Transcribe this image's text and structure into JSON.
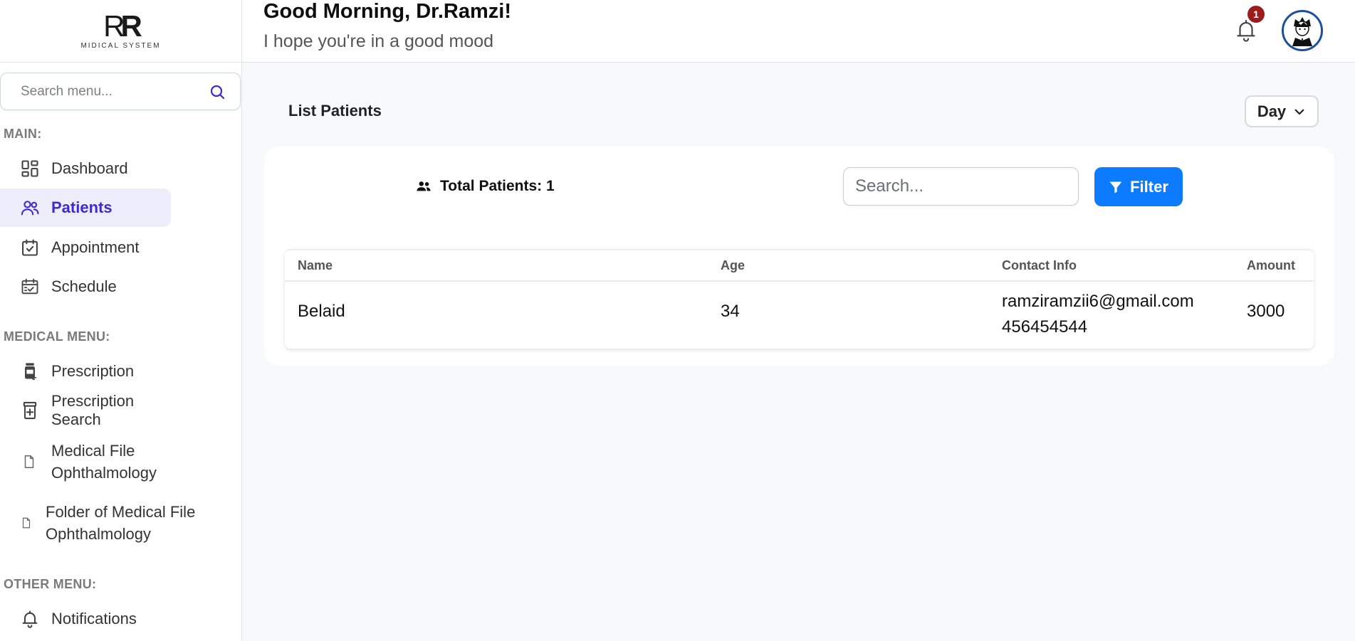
{
  "brand": {
    "logo_text_1": "R",
    "logo_text_2": "R",
    "logo_sub": "MIDICAL SYSTEM"
  },
  "sidebar": {
    "search_placeholder": "Search menu...",
    "sections": {
      "main": "MAIN:",
      "medical": "MEDICAL MENU:",
      "other": "OTHER MENU:"
    },
    "items": {
      "dashboard": "Dashboard",
      "patients": "Patients",
      "appointment": "Appointment",
      "schedule": "Schedule",
      "prescription": "Prescription",
      "prescription_search": "Prescription Search",
      "medical_file_line1": "Medical File",
      "medical_file_line2": "Ophthalmology",
      "folder_line1": "Folder of Medical File",
      "folder_line2": "Ophthalmology",
      "notifications": "Notifications"
    },
    "active": "patients"
  },
  "header": {
    "greeting": "Good Morning, Dr.Ramzi!",
    "subtitle": "I hope you're in a good mood",
    "notification_count": "1"
  },
  "main": {
    "title": "List Patients",
    "period": "Day",
    "total_label": "Total Patients: 1",
    "search_placeholder": "Search...",
    "filter_label": "Filter",
    "table": {
      "headers": {
        "name": "Name",
        "age": "Age",
        "contact": "Contact Info",
        "amount": "Amount"
      },
      "rows": [
        {
          "name": "Belaid",
          "age": "34",
          "email": "ramziramzii6@gmail.com",
          "phone": "456454544",
          "amount": "3000"
        }
      ]
    }
  },
  "colors": {
    "accent": "#0d7bff",
    "active_nav": "#3c2bd0",
    "badge": "#9b1c1c"
  }
}
